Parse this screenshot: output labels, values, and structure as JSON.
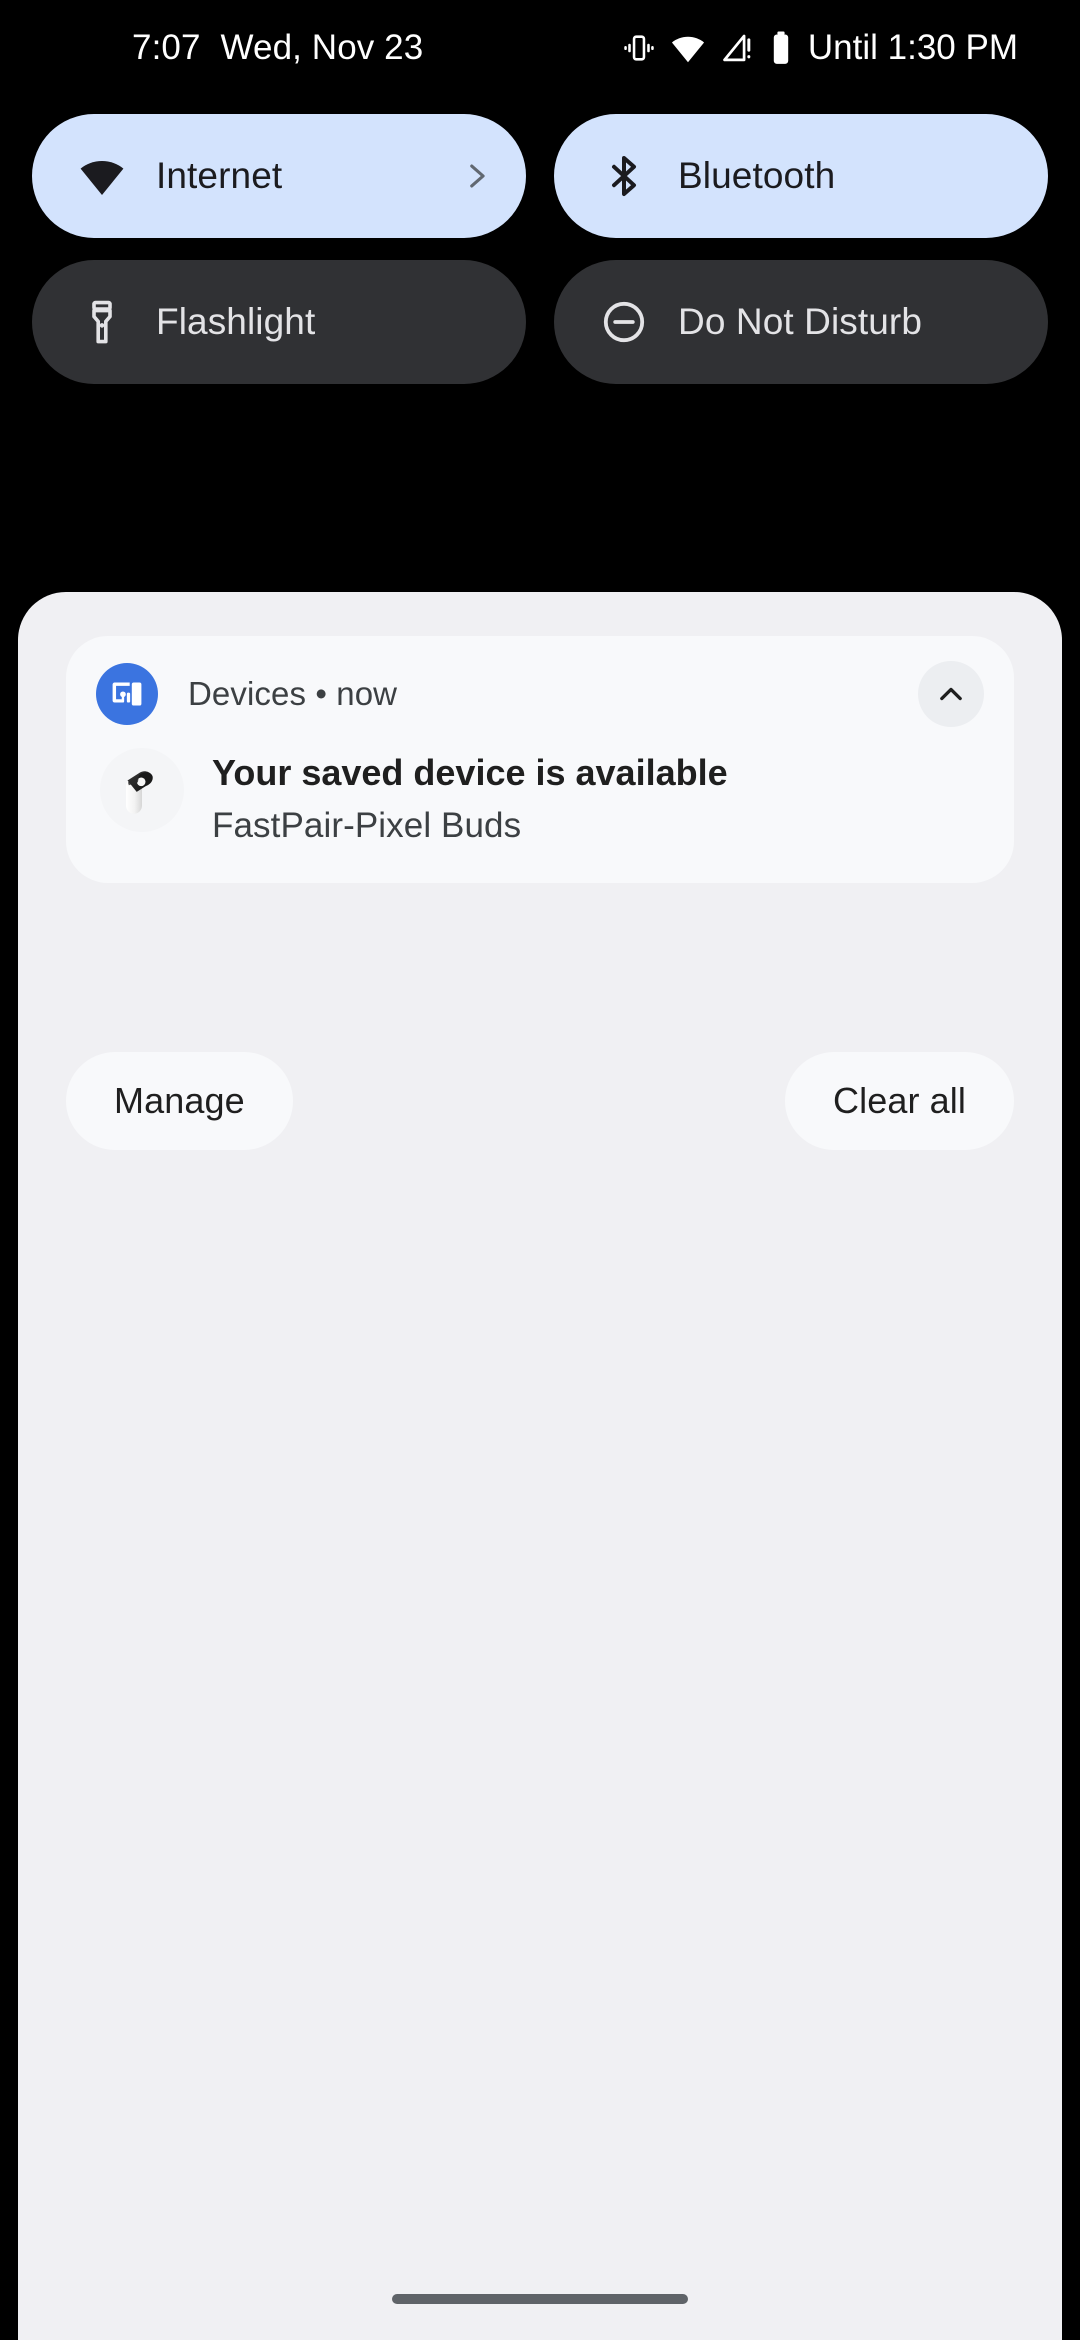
{
  "status_bar": {
    "time": "7:07",
    "date": "Wed, Nov 23",
    "battery_status": "Until 1:30 PM",
    "icons": {
      "vibrate": "vibrate-icon",
      "wifi": "wifi-icon",
      "signal": "cell-signal-no-sim-icon",
      "battery": "battery-icon"
    }
  },
  "quick_settings": {
    "tiles": [
      {
        "label": "Internet",
        "icon": "wifi-icon",
        "state": "on",
        "has_chevron": true
      },
      {
        "label": "Bluetooth",
        "icon": "bluetooth-icon",
        "state": "on",
        "has_chevron": false
      },
      {
        "label": "Flashlight",
        "icon": "flashlight-icon",
        "state": "off",
        "has_chevron": false
      },
      {
        "label": "Do Not Disturb",
        "icon": "do-not-disturb-icon",
        "state": "off",
        "has_chevron": false
      }
    ],
    "colors": {
      "tile_on_bg": "#d3e3fd",
      "tile_on_fg": "#1b1b1f",
      "tile_off_bg": "#303134",
      "tile_off_fg": "#e3e3e6"
    }
  },
  "notification_shade": {
    "background": "#f0f0f3",
    "notification": {
      "app_name": "Devices",
      "separator": "•",
      "time": "now",
      "header_text": "Devices • now",
      "app_icon": "devices-icon",
      "app_icon_color": "#3b74e0",
      "title": "Your saved device is available",
      "subtitle": "FastPair-Pixel Buds",
      "thumbnail_icon": "pixel-buds-case-icon",
      "expand_icon": "chevron-up-icon",
      "card_background": "#f8f9fb"
    },
    "actions": {
      "manage_label": "Manage",
      "clear_all_label": "Clear all"
    }
  },
  "home_indicator": {
    "color": "#5f6368"
  }
}
